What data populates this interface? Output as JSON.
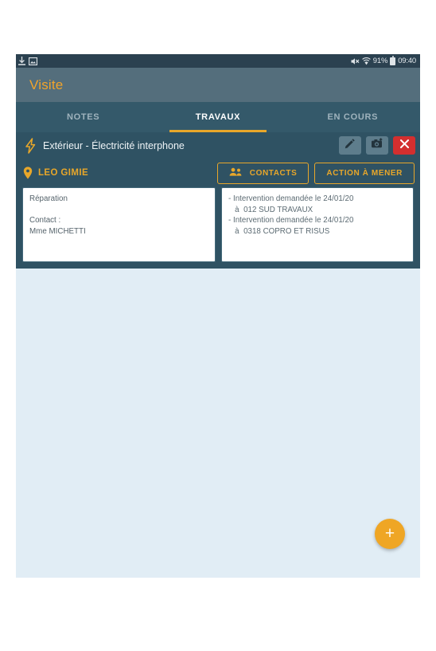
{
  "status_bar": {
    "left_icons": [
      "download-icon",
      "screenshot-icon"
    ],
    "mute_icon": "volume-mute-icon",
    "wifi_icon": "wifi-icon",
    "battery_text": "91%",
    "battery_icon": "battery-icon",
    "time": "09:40"
  },
  "app_bar": {
    "title": "Visite"
  },
  "tabs": [
    {
      "label": "NOTES",
      "active": false
    },
    {
      "label": "TRAVAUX",
      "active": true
    },
    {
      "label": "EN COURS",
      "active": false
    }
  ],
  "item": {
    "category_icon": "lightning-bolt-icon",
    "title": "Extérieur - Électricité interphone",
    "actions": {
      "edit_icon": "pencil-icon",
      "photo_icon": "camera-add-icon",
      "close_icon": "close-icon"
    }
  },
  "location": {
    "pin_icon": "location-pin-icon",
    "name": "LEO GIMIE",
    "contacts_button": {
      "label": "CONTACTS",
      "icon": "people-icon"
    },
    "action_button": {
      "label": "ACTION À MENER"
    }
  },
  "cards": {
    "left": "Réparation\n\nContact :\nMme MICHETTI",
    "right": "- Intervention demandée le 24/01/20\n   à  012 SUD TRAVAUX\n- Intervention demandée le 24/01/20\n   à  0318 COPRO ET RISUS"
  },
  "fab": {
    "label": "+",
    "icon": "plus-icon"
  },
  "colors": {
    "accent": "#e8a72a",
    "panel": "#2f5263",
    "appbar": "#546e7c",
    "tabbar": "#34596a",
    "content_bg": "#e1edf5",
    "danger": "#d32f2f"
  }
}
